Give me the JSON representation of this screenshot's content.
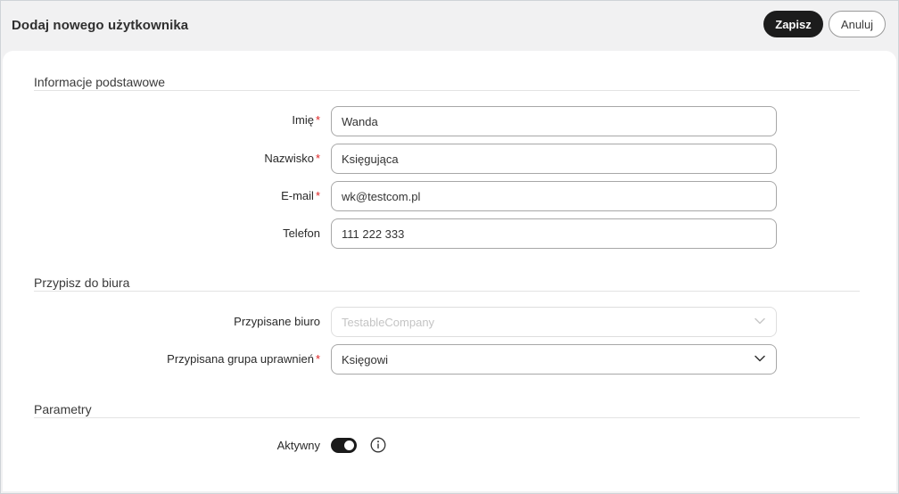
{
  "header": {
    "title": "Dodaj nowego użytkownika",
    "save_label": "Zapisz",
    "cancel_label": "Anuluj"
  },
  "sections": {
    "basic": {
      "title": "Informacje podstawowe"
    },
    "office": {
      "title": "Przypisz do biura"
    },
    "params": {
      "title": "Parametry"
    }
  },
  "fields": {
    "first_name": {
      "label": "Imię",
      "required": "*",
      "value": "Wanda"
    },
    "last_name": {
      "label": "Nazwisko",
      "required": "*",
      "value": "Księgująca"
    },
    "email": {
      "label": "E-mail",
      "required": "*",
      "value": "wk@testcom.pl"
    },
    "phone": {
      "label": "Telefon",
      "value": "111 222 333"
    },
    "office": {
      "label": "Przypisane biuro",
      "value": "TestableCompany",
      "state": "disabled"
    },
    "group": {
      "label": "Przypisana grupa uprawnień",
      "required": "*",
      "value": "Księgowi"
    },
    "active": {
      "label": "Aktywny",
      "state": "on"
    }
  },
  "icons": {
    "select_arrow": "chevron-down-icon",
    "info": "info-icon"
  },
  "colors": {
    "primary_button": "#1c1c1c",
    "required_marker": "#dd2222",
    "toggle_on": "#1a1a1a"
  }
}
